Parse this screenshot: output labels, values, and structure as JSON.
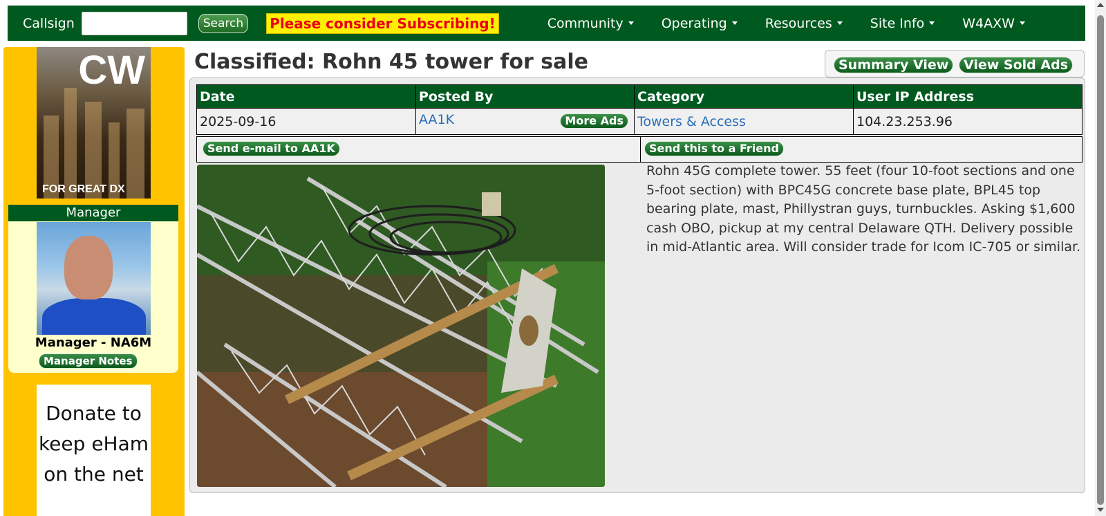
{
  "header": {
    "callsign_label": "Callsign",
    "callsign_value": "",
    "search_label": "Search",
    "subscribe_label": "Please consider Subscribing!",
    "menu": [
      {
        "label": "Community"
      },
      {
        "label": "Operating"
      },
      {
        "label": "Resources"
      },
      {
        "label": "Site Info"
      },
      {
        "label": "W4AXW"
      }
    ]
  },
  "sidebar": {
    "banner_title": "CW",
    "banner_subtitle": "FOR GREAT DX",
    "manager_heading": "Manager",
    "manager_name": "Manager - NA6M",
    "manager_notes_label": "Manager Notes",
    "donate_text": "Donate to keep eHam on the net"
  },
  "main": {
    "title": "Classified: Rohn 45 tower for sale",
    "summary_view_label": "Summary View",
    "view_sold_label": "View Sold Ads",
    "columns": [
      "Date",
      "Posted By",
      "Category",
      "User IP Address"
    ],
    "ad": {
      "date": "2025-09-16",
      "posted_by": "AA1K",
      "more_ads_label": "More Ads",
      "category": "Towers & Access",
      "ip": "104.23.253.96"
    },
    "send_email_label": "Send e-mail to AA1K",
    "send_friend_label": "Send this to a Friend",
    "description": "Rohn 45G complete tower. 55 feet (four 10-foot sections and one 5-foot section) with BPC45G concrete base plate, BPL45 top bearing plate, mast, Phillystran guys, turnbuckles. Asking $1,600 cash OBO, pickup at my central Delaware QTH. Delivery possible in mid-Atlantic area. Will consider trade for Icom IC-705 or similar."
  },
  "colors": {
    "nav_green": "#005a1f",
    "sidebar_yellow": "#ffc300",
    "subscribe_bg": "#ffef00",
    "subscribe_text": "#e8001a",
    "link_blue": "#2a6ebb"
  }
}
